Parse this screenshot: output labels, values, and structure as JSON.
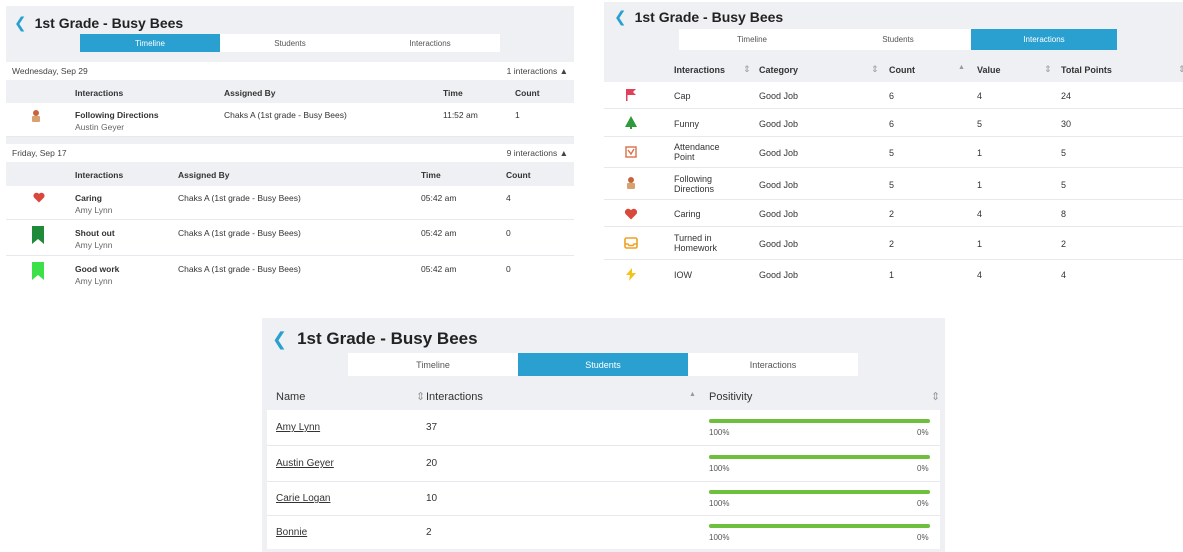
{
  "class_title": "1st Grade - Busy Bees",
  "tabs": {
    "timeline": "Timeline",
    "students": "Students",
    "interactions": "Interactions"
  },
  "timeline_panel": {
    "columns": {
      "interactions": "Interactions",
      "assigned_by": "Assigned By",
      "time": "Time",
      "count": "Count"
    },
    "sections": [
      {
        "date": "Wednesday, Sep 29",
        "summary": "1 interactions",
        "rows": [
          {
            "icon": "following-directions-icon",
            "name": "Following Directions",
            "student": "Austin Geyer",
            "assigned_by": "Chaks A (1st grade - Busy Bees)",
            "time": "11:52 am",
            "count": "1"
          }
        ]
      },
      {
        "date": "Friday, Sep 17",
        "summary": "9 interactions",
        "rows": [
          {
            "icon": "heart-icon",
            "name": "Caring",
            "student": "Amy Lynn",
            "assigned_by": "Chaks A (1st grade - Busy Bees)",
            "time": "05:42 am",
            "count": "4"
          },
          {
            "icon": "bookmark-icon",
            "name": "Shout out",
            "student": "Amy Lynn",
            "assigned_by": "Chaks A (1st grade - Busy Bees)",
            "time": "05:42 am",
            "count": "0"
          },
          {
            "icon": "bookmark-icon",
            "name": "Good work",
            "student": "Amy Lynn",
            "assigned_by": "Chaks A (1st grade - Busy Bees)",
            "time": "05:42 am",
            "count": "0"
          }
        ]
      }
    ]
  },
  "interactions_panel": {
    "columns": {
      "interactions": "Interactions",
      "category": "Category",
      "count": "Count",
      "value": "Value",
      "total_points": "Total Points"
    },
    "rows": [
      {
        "icon": "flag-icon",
        "name_line1": "Cap",
        "name_line2": "",
        "category": "Good Job",
        "count": "6",
        "value": "4",
        "total": "24"
      },
      {
        "icon": "tree-icon",
        "name_line1": "Funny",
        "name_line2": "",
        "category": "Good Job",
        "count": "6",
        "value": "5",
        "total": "30"
      },
      {
        "icon": "attendance-icon",
        "name_line1": "Attendance",
        "name_line2": "Point",
        "category": "Good Job",
        "count": "5",
        "value": "1",
        "total": "5"
      },
      {
        "icon": "following-directions-icon",
        "name_line1": "Following",
        "name_line2": "Directions",
        "category": "Good Job",
        "count": "5",
        "value": "1",
        "total": "5"
      },
      {
        "icon": "heart-icon",
        "name_line1": "Caring",
        "name_line2": "",
        "category": "Good Job",
        "count": "2",
        "value": "4",
        "total": "8"
      },
      {
        "icon": "inbox-icon",
        "name_line1": "Turned in",
        "name_line2": "Homework",
        "category": "Good Job",
        "count": "2",
        "value": "1",
        "total": "2"
      },
      {
        "icon": "lightning-icon",
        "name_line1": "IOW",
        "name_line2": "",
        "category": "Good Job",
        "count": "1",
        "value": "4",
        "total": "4"
      }
    ]
  },
  "students_panel": {
    "columns": {
      "name": "Name",
      "interactions": "Interactions",
      "positivity": "Positivity"
    },
    "rows": [
      {
        "name": "Amy Lynn",
        "interactions": "37",
        "positivity": 1.0,
        "left_label": "100%",
        "right_label": "0%"
      },
      {
        "name": "Austin Geyer",
        "interactions": "20",
        "positivity": 1.0,
        "left_label": "100%",
        "right_label": "0%"
      },
      {
        "name": "Carie Logan",
        "interactions": "10",
        "positivity": 1.0,
        "left_label": "100%",
        "right_label": "0%"
      },
      {
        "name": "Bonnie",
        "interactions": "2",
        "positivity": 1.0,
        "left_label": "100%",
        "right_label": "0%"
      }
    ]
  },
  "colors": {
    "accent": "#2aa0d0",
    "positivity_bar": "#6fbf3f",
    "heart": "#d9483b",
    "bookmark_dark": "#1e8a3a",
    "bookmark_light": "#3ee04a",
    "flag": "#e0405a",
    "tree": "#2e9a3a",
    "lightning": "#f2c318",
    "inbox": "#f0a020"
  }
}
